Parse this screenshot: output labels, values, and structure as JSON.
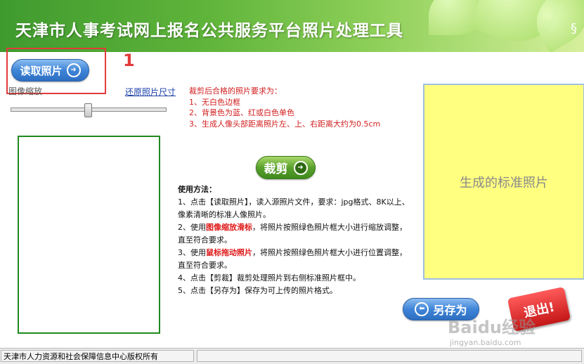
{
  "header": {
    "title": "天津市人事考试网上报名公共服务平台照片处理工具",
    "icon": "leaf-hook-icon"
  },
  "annotation": {
    "number": "1"
  },
  "left": {
    "read_photo_label": "读取照片",
    "zoom_label": "图像缩放",
    "restore_link": "还原照片尺寸",
    "zoom_level": 0.5
  },
  "requirements": {
    "title": "裁剪后合格的照片要求为：",
    "items": [
      "1、无白色边框",
      "2、背景色为蓝、红或白色单色",
      "3、生成人像头部距离照片左、上、右距离大约为0.5cm"
    ]
  },
  "crop_label": "裁剪",
  "usage": {
    "title": "使用方法：",
    "line1": "1、点击【读取照片】，读入源照片文件，要求：jpg格式、8K以上、像素清晰的标准人像照片。",
    "line2_a": "2、使用",
    "line2_hl": "图像缩放滑标",
    "line2_b": "，将照片按照绿色照片框大小进行缩放调整，直至符合要求。",
    "line3_a": "3、使用",
    "line3_hl": "鼠标拖动照片",
    "line3_b": "，将照片按照绿色照片框大小进行位置调整，直至符合要求。",
    "line4": "4、点击【剪裁】裁剪处理照片到右侧标准照片框中。",
    "line5": "5、点击【另存为】保存为可上传的照片格式。"
  },
  "right": {
    "placeholder": "生成的标准照片",
    "save_label": "另存为"
  },
  "exit_label": "退出!",
  "watermark": {
    "line1": "Baidu经验",
    "line2": "jingyan.baidu.com"
  },
  "status_bar": {
    "text": "天津市人力资源和社会保障信息中心版权所有"
  },
  "colors": {
    "header_green": "#5fb43a",
    "annotation_red": "#e23b3b",
    "photo_frame_green": "#1f8a1f",
    "standard_photo_yellow": "#ffff80"
  }
}
